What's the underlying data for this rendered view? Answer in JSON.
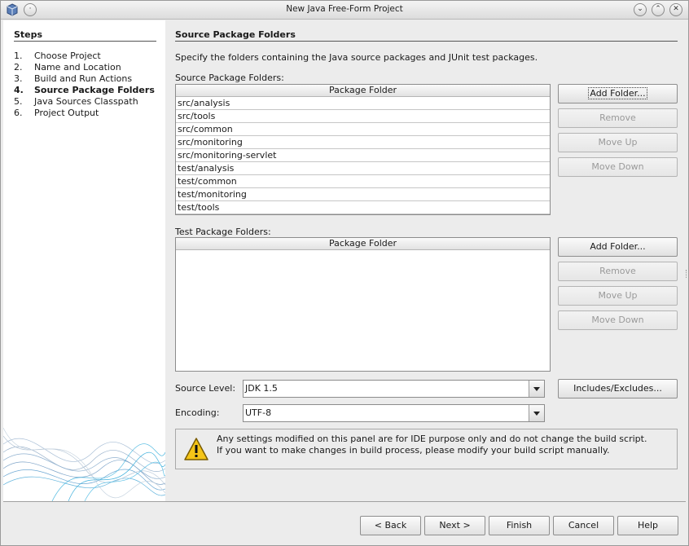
{
  "window": {
    "title": "New Java Free-Form Project"
  },
  "steps": {
    "heading": "Steps",
    "items": [
      {
        "num": "1.",
        "label": "Choose Project"
      },
      {
        "num": "2.",
        "label": "Name and Location"
      },
      {
        "num": "3.",
        "label": "Build and Run Actions"
      },
      {
        "num": "4.",
        "label": "Source Package Folders",
        "active": true
      },
      {
        "num": "5.",
        "label": "Java Sources Classpath"
      },
      {
        "num": "6.",
        "label": "Project Output"
      }
    ]
  },
  "main": {
    "title": "Source Package Folders",
    "description": "Specify the folders containing the Java source packages and JUnit test packages.",
    "source": {
      "label": "Source Package Folders:",
      "column": "Package Folder",
      "rows": [
        "src/analysis",
        "src/tools",
        "src/common",
        "src/monitoring",
        "src/monitoring-servlet",
        "test/analysis",
        "test/common",
        "test/monitoring",
        "test/tools"
      ],
      "add": "Add Folder...",
      "remove": "Remove",
      "move_up": "Move Up",
      "move_down": "Move Down"
    },
    "test": {
      "label": "Test Package Folders:",
      "column": "Package Folder",
      "add": "Add Folder...",
      "remove": "Remove",
      "move_up": "Move Up",
      "move_down": "Move Down"
    },
    "source_level": {
      "label": "Source Level:",
      "value": "JDK 1.5"
    },
    "includes_button": "Includes/Excludes...",
    "encoding": {
      "label": "Encoding:",
      "value": "UTF-8"
    },
    "note": {
      "line1": "Any settings modified on this panel are for IDE purpose only and do not change the build script.",
      "line2": "If you want to make changes in build process, please modify your build script manually."
    }
  },
  "buttons": {
    "back": "< Back",
    "next": "Next >",
    "finish": "Finish",
    "cancel": "Cancel",
    "help": "Help"
  }
}
